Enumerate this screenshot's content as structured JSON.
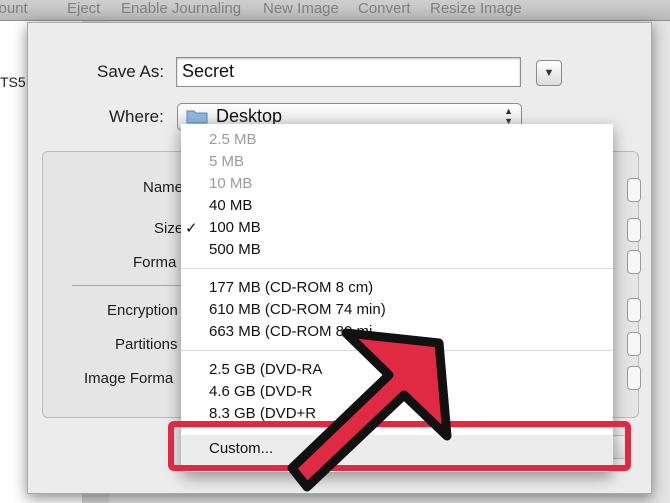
{
  "toolbar": {
    "items": [
      "Mount",
      "Eject",
      "Enable Journaling",
      "New Image",
      "Convert",
      "Resize Image"
    ]
  },
  "sidebar": {
    "partial_item": "TS5"
  },
  "dialog": {
    "save_as_label": "Save As:",
    "save_as_value": "Secret",
    "where_label": "Where:",
    "where_value": "Desktop",
    "fields": {
      "name_label": "Name",
      "size_label": "Size",
      "format_label": "Forma",
      "encryption_label": "Encryption",
      "partitions_label": "Partitions",
      "image_format_label": "Image Forma"
    }
  },
  "size_menu": {
    "items": [
      {
        "label": "2.5 MB",
        "enabled": false,
        "checked": false
      },
      {
        "label": "5 MB",
        "enabled": false,
        "checked": false
      },
      {
        "label": "10 MB",
        "enabled": false,
        "checked": false
      },
      {
        "label": "40 MB",
        "enabled": true,
        "checked": false
      },
      {
        "label": "100 MB",
        "enabled": true,
        "checked": true
      },
      {
        "label": "500 MB",
        "enabled": true,
        "checked": false
      },
      {
        "label": "177 MB (CD-ROM 8 cm)",
        "enabled": true,
        "checked": false
      },
      {
        "label": "610 MB (CD-ROM 74 min)",
        "enabled": true,
        "checked": false
      },
      {
        "label": "663 MB (CD-ROM 80 mi",
        "enabled": true,
        "checked": false
      },
      {
        "label": "2.5 GB (DVD-RA",
        "enabled": true,
        "checked": false
      },
      {
        "label": "4.6 GB (DVD-R",
        "enabled": true,
        "checked": false
      },
      {
        "label": "8.3 GB (DVD+R",
        "enabled": true,
        "checked": false
      }
    ],
    "checkmark": "✓",
    "custom_label": "Custom..."
  },
  "annotation": {
    "highlight_color": "#e02a44",
    "arrow_color": "#e02a44"
  }
}
